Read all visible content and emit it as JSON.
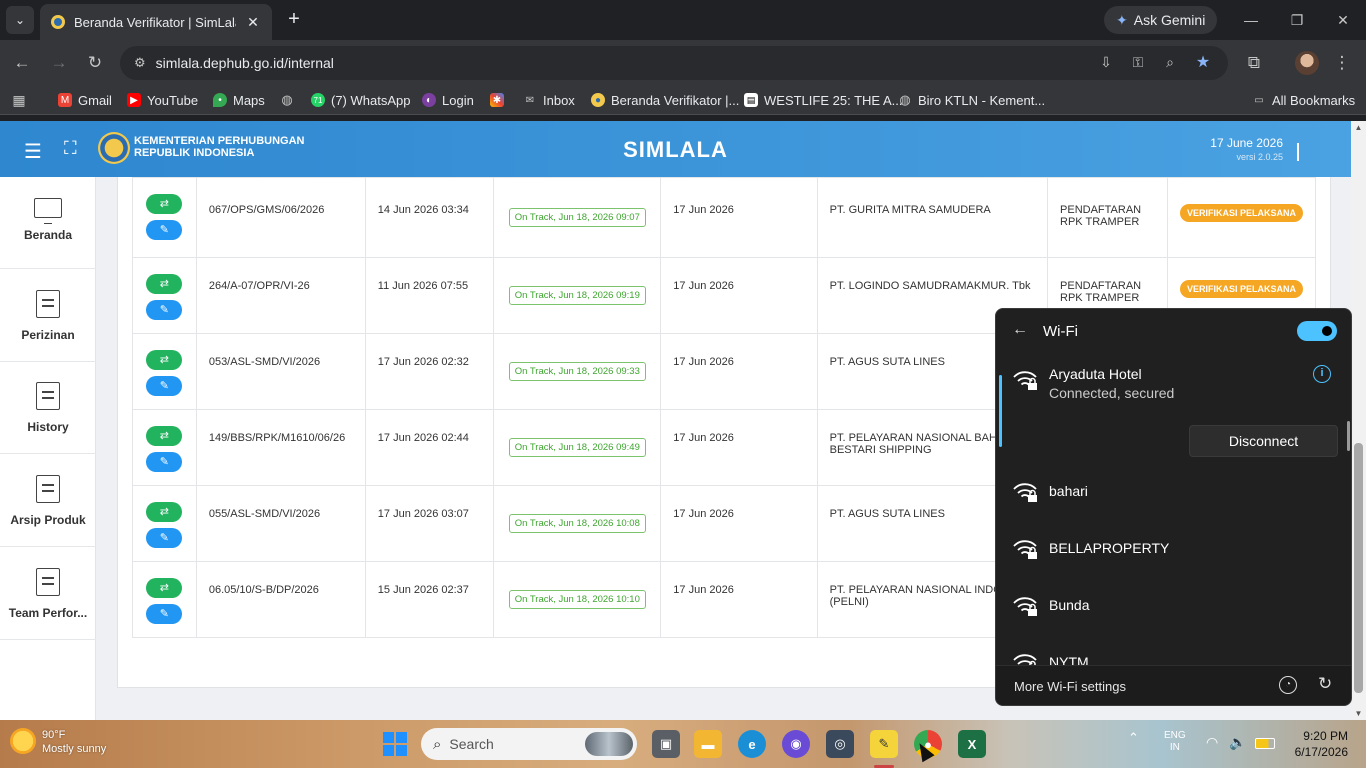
{
  "browser": {
    "tab_title": "Beranda Verifikator | SimLala",
    "url": "simlala.dephub.go.id/internal",
    "ask_gemini": "Ask Gemini",
    "bookmarks": [
      "Gmail",
      "YouTube",
      "Maps",
      "(7) WhatsApp",
      "Login",
      "Inbox",
      "Beranda Verifikator |...",
      "WESTLIFE 25: THE A...",
      "Biro KTLN - Kement..."
    ],
    "whatsapp_count": "71",
    "all_bookmarks": "All Bookmarks"
  },
  "app": {
    "ministry_line1": "KEMENTERIAN PERHUBUNGAN",
    "ministry_line2": "REPUBLIK INDONESIA",
    "title": "SIMLALA",
    "date": "17 June 2026",
    "version": "versi 2.0.25"
  },
  "sidebar": {
    "items": [
      {
        "label": "Beranda",
        "icon": "monitor-icon"
      },
      {
        "label": "Perizinan",
        "icon": "document-icon"
      },
      {
        "label": "History",
        "icon": "document-icon"
      },
      {
        "label": "Arsip Produk",
        "icon": "document-icon"
      },
      {
        "label": "Team Perfor...",
        "icon": "document-icon"
      }
    ]
  },
  "table": {
    "rows": [
      {
        "number": "067/OPS/GMS/06/2026",
        "submitted": "14 Jun 2026 03:34",
        "status": "On Track, Jun 18, 2026 09:07",
        "date": "17 Jun 2026",
        "company": "PT. GURITA MITRA SAMUDERA",
        "type": "PENDAFTARAN RPK TRAMPER",
        "stage": "VERIFIKASI PELAKSANA"
      },
      {
        "number": "264/A-07/OPR/VI-26",
        "submitted": "11 Jun 2026 07:55",
        "status": "On Track, Jun 18, 2026 09:19",
        "date": "17 Jun 2026",
        "company": "PT. LOGINDO SAMUDRAMAKMUR. Tbk",
        "type": "PENDAFTARAN RPK TRAMPER",
        "stage": "VERIFIKASI PELAKSANA"
      },
      {
        "number": "053/ASL-SMD/VI/2026",
        "submitted": "17 Jun 2026 02:32",
        "status": "On Track, Jun 18, 2026 09:33",
        "date": "17 Jun 2026",
        "company": "PT. AGUS SUTA LINES",
        "type": "",
        "stage": ""
      },
      {
        "number": "149/BBS/RPK/M1610/06/26",
        "submitted": "17 Jun 2026 02:44",
        "status": "On Track, Jun 18, 2026 09:49",
        "date": "17 Jun 2026",
        "company": "PT. PELAYARAN NASIONAL BAHT BESTARI SHIPPING",
        "type": "",
        "stage": ""
      },
      {
        "number": "055/ASL-SMD/VI/2026",
        "submitted": "17 Jun 2026 03:07",
        "status": "On Track, Jun 18, 2026 10:08",
        "date": "17 Jun 2026",
        "company": "PT. AGUS SUTA LINES",
        "type": "",
        "stage": ""
      },
      {
        "number": "06.05/10/S-B/DP/2026",
        "submitted": "15 Jun 2026 02:37",
        "status": "On Track, Jun 18, 2026 10:10",
        "date": "17 Jun 2026",
        "company": "PT. PELAYARAN NASIONAL INDO (PELNI)",
        "type": "",
        "stage": ""
      }
    ]
  },
  "wifi": {
    "title": "Wi-Fi",
    "connected_name": "Aryaduta Hotel",
    "connected_status": "Connected, secured",
    "disconnect": "Disconnect",
    "networks": [
      "bahari",
      "BELLAPROPERTY",
      "Bunda",
      "NYTM"
    ],
    "more_settings": "More Wi-Fi settings"
  },
  "taskbar": {
    "temperature": "90°F",
    "weather": "Mostly sunny",
    "search": "Search",
    "lang1": "ENG",
    "lang2": "IN",
    "time": "9:20 PM",
    "date": "6/17/2026"
  }
}
